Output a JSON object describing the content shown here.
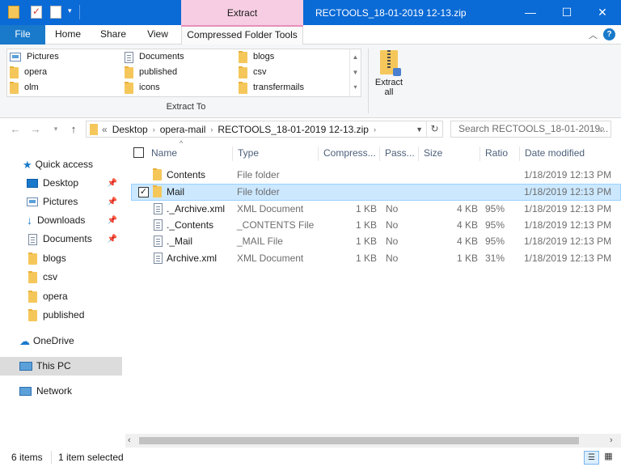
{
  "window": {
    "title": "RECTOOLS_18-01-2019 12-13.zip",
    "contextual_tab_group": "Extract",
    "minimize_icon": "minimize-icon",
    "maximize_icon": "maximize-icon",
    "close_icon": "close-icon"
  },
  "menu": {
    "file": "File",
    "home": "Home",
    "share": "Share",
    "view": "View",
    "compressed_tools": "Compressed Folder Tools"
  },
  "ribbon": {
    "gallery": [
      {
        "label": "Pictures",
        "icon": "pictures-icon"
      },
      {
        "label": "Documents",
        "icon": "documents-icon"
      },
      {
        "label": "blogs",
        "icon": "folder-icon"
      },
      {
        "label": "opera",
        "icon": "folder-icon"
      },
      {
        "label": "published",
        "icon": "folder-icon"
      },
      {
        "label": "csv",
        "icon": "folder-icon"
      },
      {
        "label": "olm",
        "icon": "folder-icon"
      },
      {
        "label": "icons",
        "icon": "folder-icon"
      },
      {
        "label": "transfermails",
        "icon": "folder-icon"
      }
    ],
    "group_label": "Extract To",
    "extract_all_line1": "Extract",
    "extract_all_line2": "all"
  },
  "address": {
    "prefix": "«",
    "crumbs": [
      "Desktop",
      "opera-mail",
      "RECTOOLS_18-01-2019 12-13.zip"
    ],
    "search_placeholder": "Search RECTOOLS_18-01-2019..."
  },
  "sidebar": {
    "quick_access": "Quick access",
    "pinned": [
      {
        "label": "Desktop",
        "icon": "desktop-icon"
      },
      {
        "label": "Pictures",
        "icon": "pictures-icon"
      },
      {
        "label": "Downloads",
        "icon": "downloads-icon"
      },
      {
        "label": "Documents",
        "icon": "documents-icon"
      }
    ],
    "folders": [
      "blogs",
      "csv",
      "opera",
      "published"
    ],
    "onedrive": "OneDrive",
    "thispc": "This PC",
    "network": "Network"
  },
  "columns": [
    "Name",
    "Type",
    "Compress...",
    "Pass...",
    "Size",
    "Ratio",
    "Date modified"
  ],
  "files": [
    {
      "name": "Contents",
      "type": "File folder",
      "compressed": "",
      "password": "",
      "size": "",
      "ratio": "",
      "date": "1/18/2019 12:13 PM",
      "kind": "folder"
    },
    {
      "name": "Mail",
      "type": "File folder",
      "compressed": "",
      "password": "",
      "size": "",
      "ratio": "",
      "date": "1/18/2019 12:13 PM",
      "kind": "folder"
    },
    {
      "name": "._Archive.xml",
      "type": "XML Document",
      "compressed": "1 KB",
      "password": "No",
      "size": "4 KB",
      "ratio": "95%",
      "date": "1/18/2019 12:13 PM",
      "kind": "file"
    },
    {
      "name": "._Contents",
      "type": "_CONTENTS File",
      "compressed": "1 KB",
      "password": "No",
      "size": "4 KB",
      "ratio": "95%",
      "date": "1/18/2019 12:13 PM",
      "kind": "file"
    },
    {
      "name": "._Mail",
      "type": "_MAIL File",
      "compressed": "1 KB",
      "password": "No",
      "size": "4 KB",
      "ratio": "95%",
      "date": "1/18/2019 12:13 PM",
      "kind": "file"
    },
    {
      "name": "Archive.xml",
      "type": "XML Document",
      "compressed": "1 KB",
      "password": "No",
      "size": "1 KB",
      "ratio": "31%",
      "date": "1/18/2019 12:13 PM",
      "kind": "file"
    }
  ],
  "selected_row": 1,
  "status": {
    "count": "6 items",
    "selection": "1 item selected"
  },
  "colors": {
    "titlebar": "#0a6ad6",
    "file_tab": "#1979ca",
    "contextual": "#f6cde2",
    "selection": "#cce8ff"
  }
}
